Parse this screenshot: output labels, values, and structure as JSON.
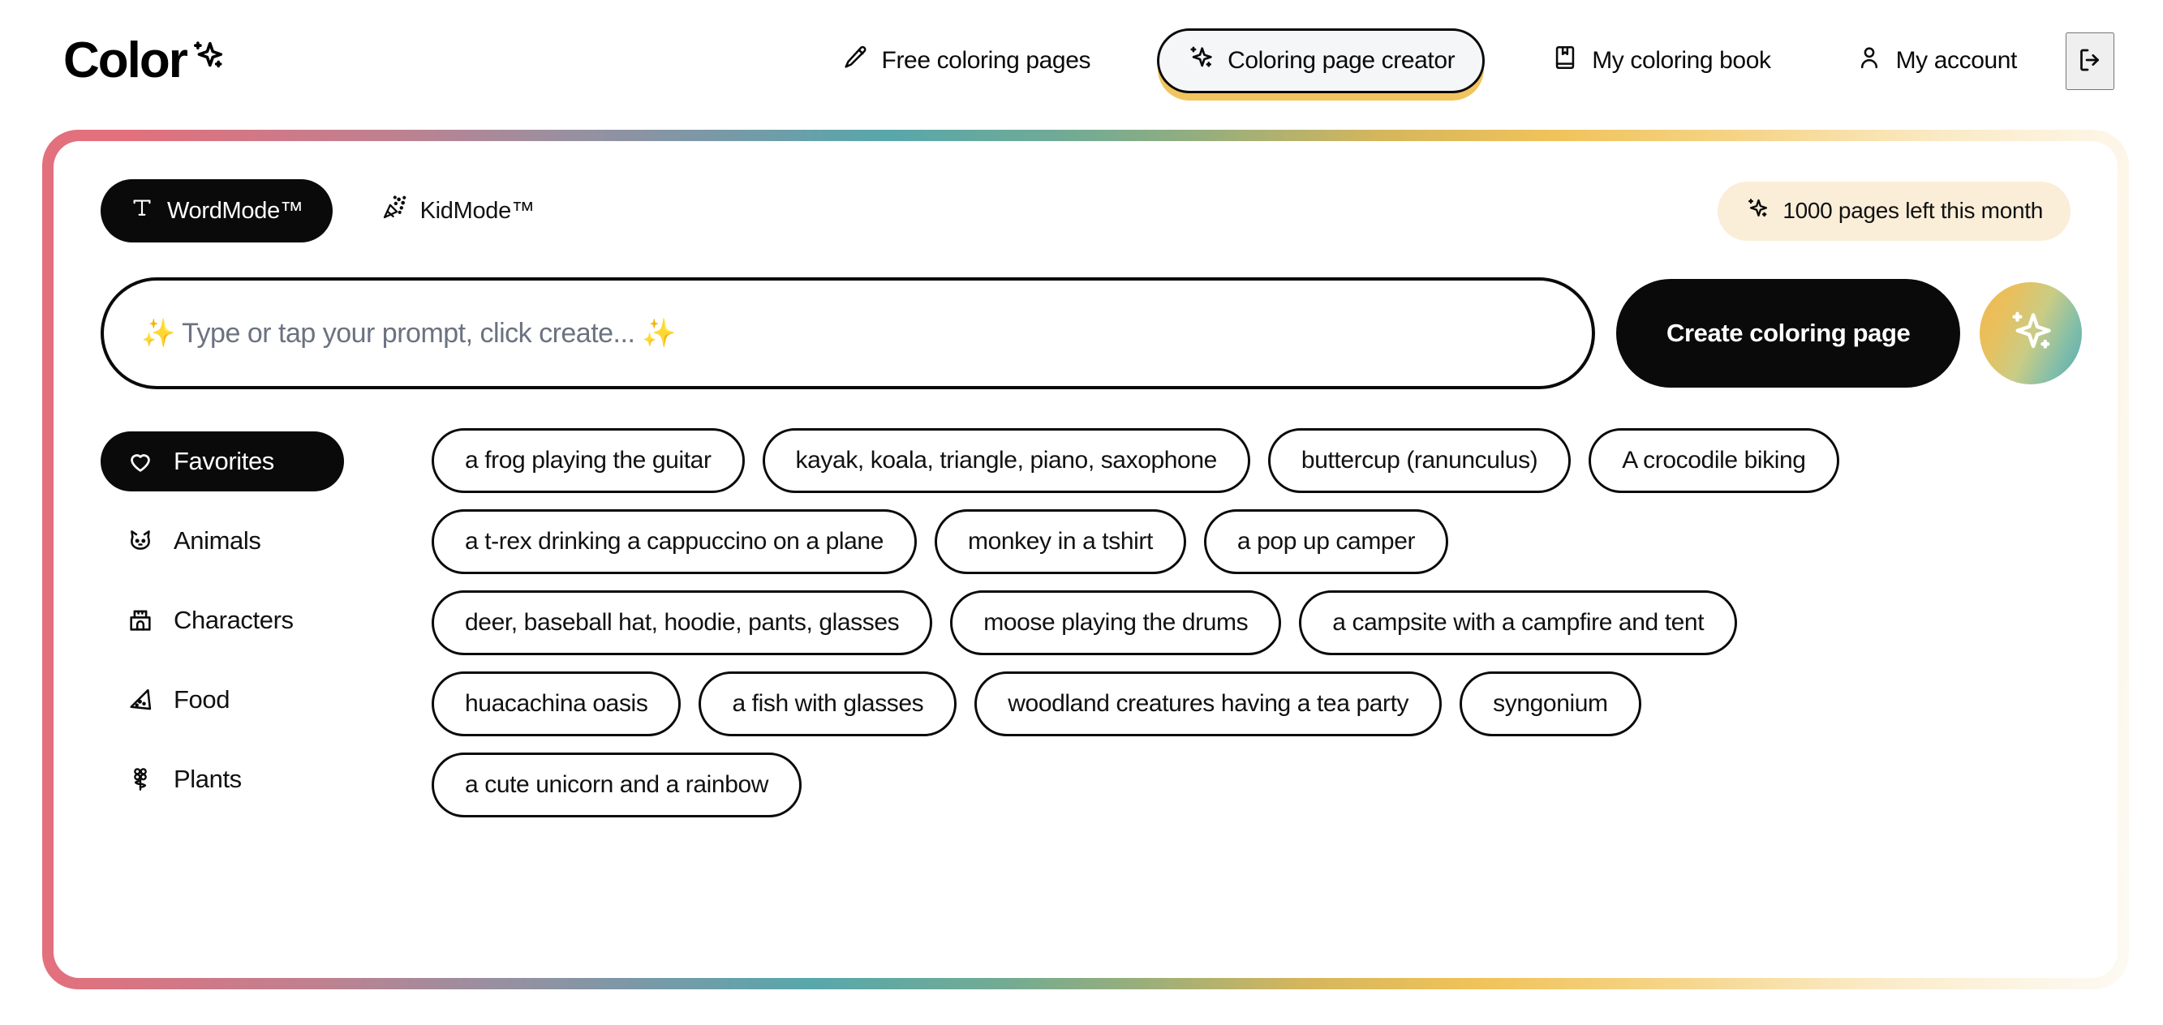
{
  "brand": {
    "name": "Color",
    "logo_sparkle_icon": "sparkle-icon"
  },
  "nav": {
    "items": [
      {
        "label": "Free coloring pages",
        "icon": "pencil-icon",
        "active": false
      },
      {
        "label": "Coloring page creator",
        "icon": "sparkle-icon",
        "active": true
      },
      {
        "label": "My coloring book",
        "icon": "book-icon",
        "active": false
      },
      {
        "label": "My account",
        "icon": "user-icon",
        "active": false
      }
    ],
    "logout_icon": "logout-icon"
  },
  "modes": {
    "items": [
      {
        "label": "WordMode™",
        "icon": "text-t-icon",
        "active": true
      },
      {
        "label": "KidMode™",
        "icon": "party-popper-icon",
        "active": false
      }
    ]
  },
  "pages_badge": {
    "icon": "sparkle-icon",
    "label": "1000 pages left this month"
  },
  "prompt": {
    "value": "",
    "placeholder": "✨ Type or tap your prompt, click create... ✨",
    "create_label": "Create coloring page",
    "surprise_icon": "sparkle-icon"
  },
  "categories": [
    {
      "label": "Favorites",
      "icon": "heart-icon",
      "active": true
    },
    {
      "label": "Animals",
      "icon": "cat-icon",
      "active": false
    },
    {
      "label": "Characters",
      "icon": "castle-icon",
      "active": false
    },
    {
      "label": "Food",
      "icon": "pizza-icon",
      "active": false
    },
    {
      "label": "Plants",
      "icon": "flower-icon",
      "active": false
    }
  ],
  "suggestions": {
    "rows": [
      [
        "a frog playing the guitar",
        "kayak, koala, triangle, piano, saxophone",
        "buttercup (ranunculus)",
        "A crocodile biking"
      ],
      [
        "a t-rex drinking a cappuccino on a plane",
        "monkey in a tshirt",
        "a pop up camper"
      ],
      [
        "deer, baseball hat, hoodie, pants, glasses",
        "moose playing the drums",
        "a campsite with a campfire and tent"
      ],
      [
        "huacachina oasis",
        "a fish with glasses",
        "woodland creatures having a tea party",
        "syngonium"
      ],
      [
        "a cute unicorn and a rainbow"
      ]
    ]
  },
  "colors": {
    "ink": "#0a0a0a",
    "accent_yellow": "#f1c45f",
    "badge_cream": "#faeed8",
    "border_pink": "#e2707d",
    "border_teal": "#58a7ab",
    "border_gold": "#f0c35a"
  }
}
